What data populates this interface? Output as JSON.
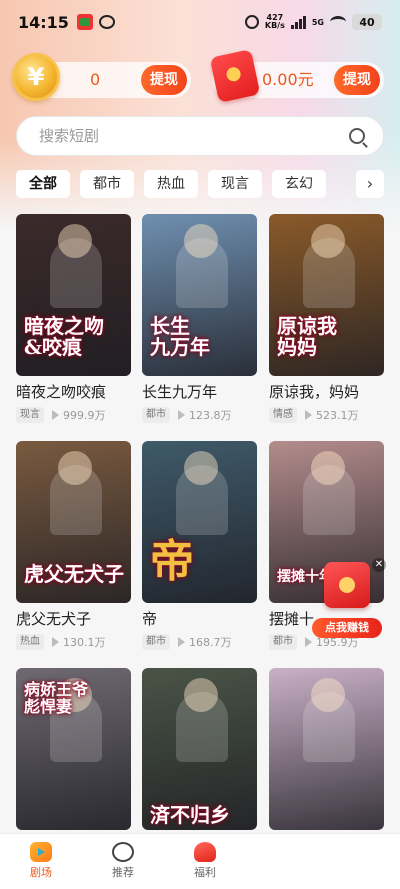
{
  "status_bar": {
    "time": "14:15",
    "net_speed_value": "427",
    "net_speed_unit": "KB/s",
    "network": "5G",
    "battery": "40"
  },
  "coins": {
    "value": "0",
    "withdraw_label": "提现"
  },
  "wallet": {
    "value": "0.00元",
    "withdraw_label": "提现"
  },
  "search": {
    "placeholder": "搜索短剧"
  },
  "categories": [
    "全部",
    "都市",
    "热血",
    "现言",
    "玄幻"
  ],
  "category_more": "›",
  "dramas": [
    {
      "title": "暗夜之吻咬痕",
      "tag": "现言",
      "views": "999.9万",
      "poster_text": "暗夜之吻\n&咬痕",
      "color": "#3b2a2a"
    },
    {
      "title": "长生九万年",
      "tag": "都市",
      "views": "123.8万",
      "poster_text": "长生\n九万年",
      "color": "#6f8fb0"
    },
    {
      "title": "原谅我，妈妈",
      "tag": "情感",
      "views": "523.1万",
      "poster_text": "原谅我\n妈妈",
      "color": "#8a5a2a"
    },
    {
      "title": "虎父无犬子",
      "tag": "热血",
      "views": "130.1万",
      "poster_text": "虎父无犬子",
      "color": "#7a5a40"
    },
    {
      "title": "帝",
      "tag": "都市",
      "views": "168.7万",
      "poster_text": "帝",
      "color": "#3f5a6a"
    },
    {
      "title": "摆摊十",
      "tag": "都市",
      "views": "195.9万",
      "poster_text": "摆摊十年",
      "color": "#b48c8c"
    },
    {
      "title": "",
      "tag": "",
      "views": "",
      "poster_text": "病娇王爷\n彪悍妻",
      "color": "#6f6a72"
    },
    {
      "title": "",
      "tag": "",
      "views": "",
      "poster_text": "済不归乡",
      "color": "#4a5446"
    },
    {
      "title": "",
      "tag": "",
      "views": "",
      "poster_text": "",
      "color": "#c9b0c6"
    }
  ],
  "promo": {
    "label": "点我赚钱",
    "close": "✕"
  },
  "bottom_nav": [
    {
      "label": "剧场",
      "active": true
    },
    {
      "label": "推荐",
      "active": false
    },
    {
      "label": "福利",
      "active": false
    }
  ],
  "colors": {
    "accent": "#f05a1e",
    "withdraw": "#f2421b"
  },
  "icons": [
    "coin-icon",
    "red-packet-icon",
    "search-icon",
    "play-icon",
    "theater-icon",
    "recommend-icon",
    "welfare-icon"
  ]
}
